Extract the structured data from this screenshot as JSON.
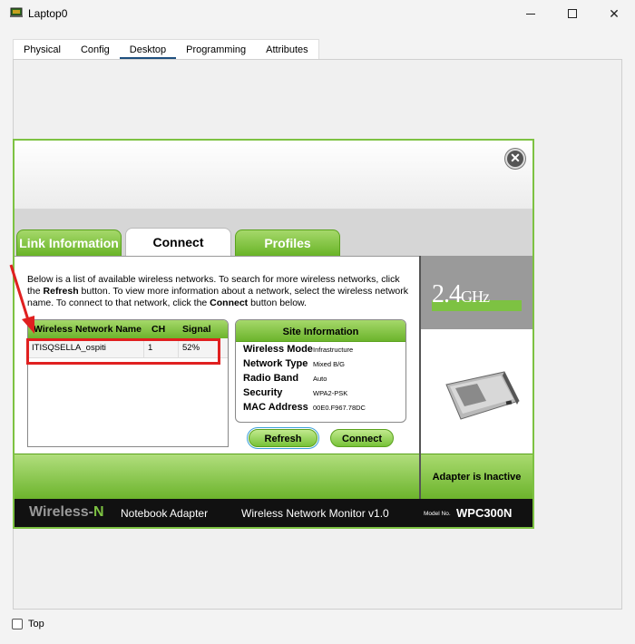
{
  "window": {
    "title": "Laptop0",
    "minimize_glyph": "—",
    "close_glyph": "✕"
  },
  "tabs": [
    {
      "label": "Physical"
    },
    {
      "label": "Config"
    },
    {
      "label": "Desktop",
      "active": true
    },
    {
      "label": "Programming"
    },
    {
      "label": "Attributes"
    }
  ],
  "app": {
    "close_glyph": "✕",
    "tabs": {
      "link": "Link Information",
      "connect": "Connect",
      "profiles": "Profiles"
    },
    "description": {
      "p1": "Below is a list of available wireless networks. To search for more wireless networks, click the ",
      "b1": "Refresh",
      "p2": " button. To view more information about a network, select the wireless network name. To connect to that network, click the ",
      "b2": "Connect",
      "p3": " button below."
    },
    "networks": {
      "headers": {
        "name": "Wireless Network Name",
        "ch": "CH",
        "signal": "Signal"
      },
      "rows": [
        {
          "name": "ITISQSELLA_ospiti",
          "ch": "1",
          "signal": "52%"
        }
      ]
    },
    "site_info": {
      "title": "Site Information",
      "rows": [
        {
          "k": "Wireless Mode",
          "v": "Infrastructure"
        },
        {
          "k": "Network Type",
          "v": "Mixed B/G"
        },
        {
          "k": "Radio Band",
          "v": "Auto"
        },
        {
          "k": "Security",
          "v": "WPA2-PSK"
        },
        {
          "k": "MAC Address",
          "v": "00E0.F967.78DC"
        }
      ]
    },
    "buttons": {
      "refresh": "Refresh",
      "connect": "Connect"
    },
    "band": {
      "main": "2.4",
      "unit": "GHz"
    },
    "status": "Adapter is Inactive",
    "footer": {
      "brand_a": "Wireless-",
      "brand_b": "N",
      "item1": "Notebook Adapter",
      "item2": "Wireless Network Monitor  v1.0",
      "model_label": "Model No.",
      "model_no": "WPC300N"
    }
  },
  "bottom": {
    "checkbox_label": "Top",
    "checked": false
  },
  "colors": {
    "accent_green": "#7dc242",
    "highlight_red": "#e02020",
    "tab_underline": "#1e4f7e"
  }
}
